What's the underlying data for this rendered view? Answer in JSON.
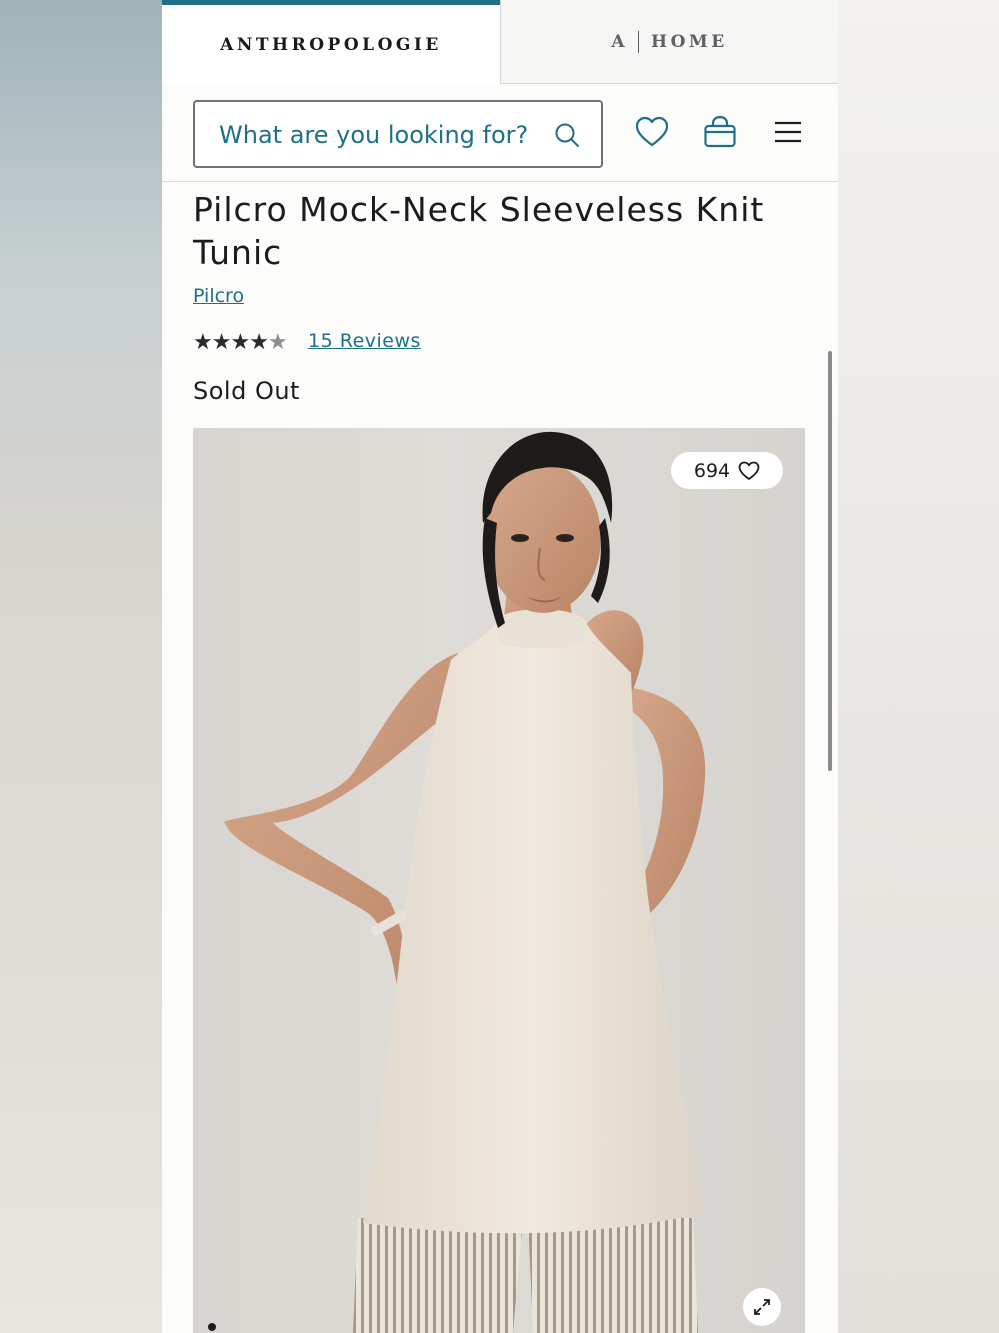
{
  "brand_tabs": {
    "anthropologie": "ANTHROPOLOGIE",
    "home_prefix": "A",
    "home_label": "HOME"
  },
  "header": {
    "search_placeholder": "What are you looking for?",
    "icons": [
      "search-icon",
      "heart-icon",
      "shopping-bag-icon",
      "hamburger-menu-icon"
    ]
  },
  "product": {
    "title": "Pilcro Mock-Neck Sleeveless Knit Tunic",
    "brand": "Pilcro",
    "rating": 4,
    "rating_max": 5,
    "reviews_label": "15 Reviews",
    "status": "Sold Out",
    "favorites_count": "694"
  },
  "colors": {
    "accent": "#1f6f87",
    "text": "#1c1c1c"
  }
}
